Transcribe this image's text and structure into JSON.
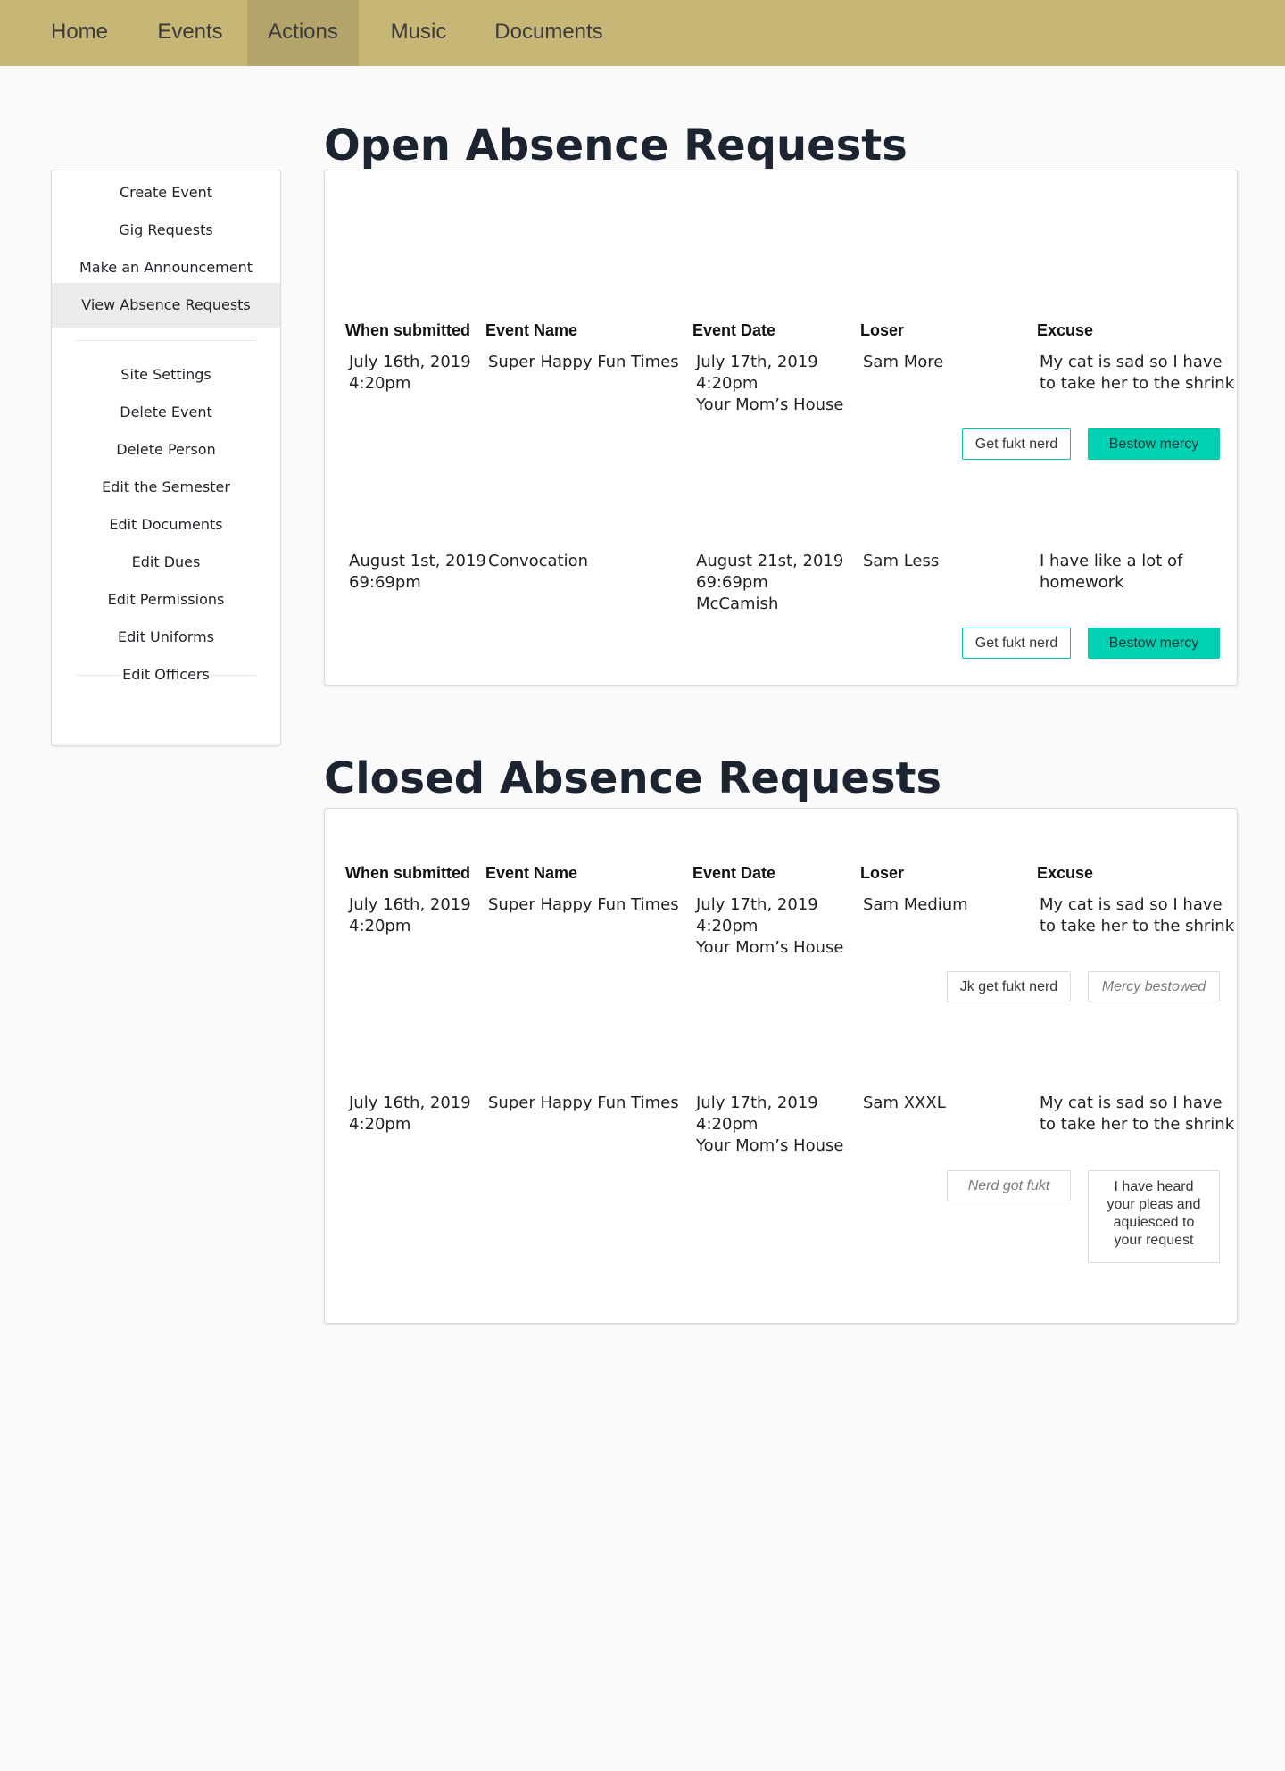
{
  "nav": {
    "items": [
      {
        "label": "Home"
      },
      {
        "label": "Events"
      },
      {
        "label": "Actions"
      },
      {
        "label": "Music"
      },
      {
        "label": "Documents"
      }
    ],
    "active": "Actions"
  },
  "sidebar": {
    "group1": [
      {
        "label": "Create Event"
      },
      {
        "label": "Gig Requests"
      },
      {
        "label": "Make an Announcement"
      },
      {
        "label": "View Absence Requests"
      }
    ],
    "group2": [
      {
        "label": "Site Settings"
      },
      {
        "label": "Delete Event"
      },
      {
        "label": "Delete Person"
      },
      {
        "label": "Edit the Semester"
      },
      {
        "label": "Edit Documents"
      },
      {
        "label": "Edit Dues"
      },
      {
        "label": "Edit Permissions"
      },
      {
        "label": "Edit Uniforms"
      },
      {
        "label": "Edit Officers"
      }
    ],
    "active": "View Absence Requests"
  },
  "columns": {
    "submitted": "When submitted",
    "event_name": "Event Name",
    "event_date": "Event Date",
    "loser": "Loser",
    "excuse": "Excuse"
  },
  "open": {
    "title": "Open Absence Requests",
    "rows": [
      {
        "submitted_date": "July 16th, 2019",
        "submitted_time": "4:20pm",
        "event_name": "Super Happy Fun Times",
        "event_date": "July 17th, 2019",
        "event_time": "4:20pm",
        "event_location": "Your Mom’s House",
        "loser": "Sam More",
        "excuse_line1": "My cat is sad so I have",
        "excuse_line2": "to take her to the shrink",
        "deny_label": "Get fukt nerd",
        "approve_label": "Bestow mercy"
      },
      {
        "submitted_date": "August 1st, 2019",
        "submitted_time": "69:69pm",
        "event_name": "Convocation",
        "event_date": "August 21st, 2019",
        "event_time": "69:69pm",
        "event_location": "McCamish",
        "loser": "Sam Less",
        "excuse_line1": "I have like a lot of",
        "excuse_line2": "homework",
        "deny_label": "Get fukt nerd",
        "approve_label": "Bestow mercy"
      }
    ]
  },
  "closed": {
    "title": "Closed Absence Requests",
    "rows": [
      {
        "submitted_date": "July 16th, 2019",
        "submitted_time": "4:20pm",
        "event_name": "Super Happy Fun Times",
        "event_date": "July 17th, 2019",
        "event_time": "4:20pm",
        "event_location": "Your Mom’s House",
        "loser": "Sam Medium",
        "excuse_line1": "My cat is sad so I have",
        "excuse_line2": "to take her to the shrink",
        "left_button": "Jk get fukt nerd",
        "right_button": "Mercy bestowed"
      },
      {
        "submitted_date": "July 16th, 2019",
        "submitted_time": "4:20pm",
        "event_name": "Super Happy Fun Times",
        "event_date": "July 17th, 2019",
        "event_time": "4:20pm",
        "event_location": "Your Mom’s House",
        "loser": "Sam XXXL",
        "excuse_line1": "My cat is sad so I have",
        "excuse_line2": "to take her to the shrink",
        "left_button": "Nerd got fukt",
        "right_button_line1": "I have heard",
        "right_button_line2": "your pleas and",
        "right_button_line3": "aquiesced to",
        "right_button_line4": "your request"
      }
    ]
  },
  "colors": {
    "nav_bg": "#c8b677",
    "nav_active": "#b5a36c",
    "accent_teal": "#00d1b2"
  }
}
